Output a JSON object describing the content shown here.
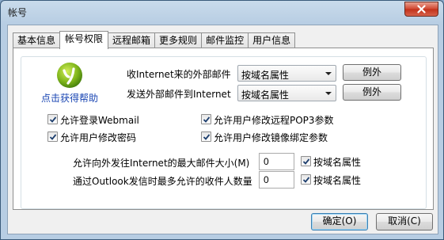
{
  "window": {
    "title": "帐号"
  },
  "tabs": [
    {
      "label": "基本信息"
    },
    {
      "label": "帐号权限"
    },
    {
      "label": "远程邮箱"
    },
    {
      "label": "更多规则"
    },
    {
      "label": "邮件监控"
    },
    {
      "label": "用户信息"
    }
  ],
  "help": {
    "label": "点击获得帮助"
  },
  "receive": {
    "label": "收Internet来的外部邮件",
    "value": "按域名属性",
    "exception_label": "例外"
  },
  "send": {
    "label": "发送外部邮件到Internet",
    "value": "按域名属性",
    "exception_label": "例外"
  },
  "permissions": {
    "webmail": {
      "label": "允许登录Webmail",
      "checked": true
    },
    "pop3": {
      "label": "允许用户修改远程POP3参数",
      "checked": true
    },
    "password": {
      "label": "允许用户修改密码",
      "checked": true
    },
    "mirror": {
      "label": "允许用户修改镜像绑定参数",
      "checked": true
    }
  },
  "max_size": {
    "label": "允许向外发往Internet的最大邮件大小(M)",
    "value": "0",
    "domain_label": "按域名属性",
    "domain_checked": true
  },
  "max_recipients": {
    "label": "通过Outlook发信时最多允许的收件人数量",
    "value": "0",
    "domain_label": "按域名属性",
    "domain_checked": true
  },
  "footer": {
    "ok_label": "确定(O)",
    "cancel_label": "取消(C)"
  }
}
